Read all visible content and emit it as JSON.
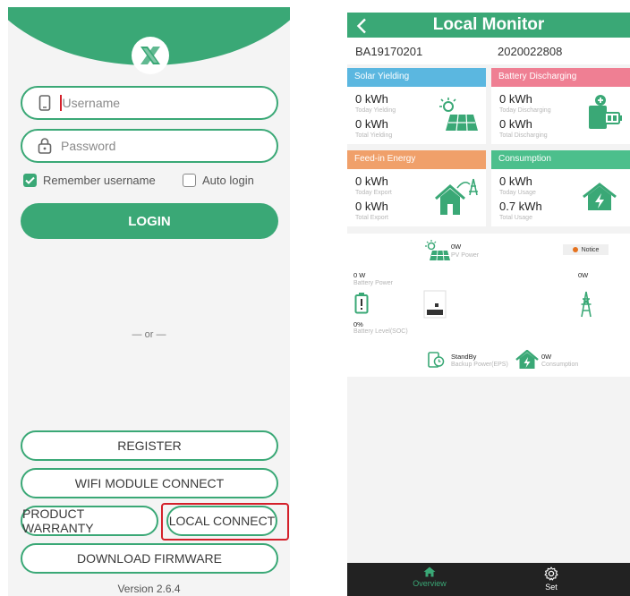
{
  "login": {
    "username_placeholder": "Username",
    "password_placeholder": "Password",
    "remember_label": "Remember username",
    "remember_checked": true,
    "auto_login_label": "Auto login",
    "auto_login_checked": false,
    "login_button": "LOGIN",
    "or_separator": "— or —",
    "register_button": "REGISTER",
    "wifi_button": "WIFI MODULE CONNECT",
    "warranty_button": "PRODUCT WARRANTY",
    "local_connect_button": "LOCAL CONNECT",
    "download_button": "DOWNLOAD FIRMWARE",
    "version": "Version 2.6.4",
    "highlight_color": "#d4202a"
  },
  "monitor": {
    "title": "Local Monitor",
    "serial_left": "BA19170201",
    "serial_right": "2020022808",
    "cards": {
      "solar": {
        "header": "Solar Yielding",
        "color": "#5bb7e0",
        "today_value": "0 kWh",
        "today_label": "Today Yielding",
        "total_value": "0 kWh",
        "total_label": "Total Yielding"
      },
      "battery": {
        "header": "Battery Discharging",
        "color": "#ef7f93",
        "today_value": "0 kWh",
        "today_label": "Today Discharging",
        "total_value": "0 kWh",
        "total_label": "Total Discharging"
      },
      "feedin": {
        "header": "Feed-in Energy",
        "color": "#f0a06a",
        "today_value": "0 kWh",
        "today_label": "Today Export",
        "total_value": "0 kWh",
        "total_label": "Total Export"
      },
      "consumption": {
        "header": "Consumption",
        "color": "#4cbf8c",
        "today_value": "0 kWh",
        "today_label": "Today Usage",
        "total_value": "0.7 kWh",
        "total_label": "Total Usage"
      }
    },
    "flow": {
      "pv_value": "0W",
      "pv_label": "PV Power",
      "notice": "Notice",
      "battery_power_value": "0 W",
      "battery_power_label": "Battery Power",
      "grid_value": "0W",
      "soc_value": "0%",
      "soc_label": "Battery Level(SOC)",
      "eps_value": "StandBy",
      "eps_label": "Backup Power(EPS)",
      "consumption_value": "0W",
      "consumption_label": "Consumption"
    },
    "tabs": {
      "overview": "Overview",
      "set": "Set"
    },
    "accent": "#3aa876"
  }
}
